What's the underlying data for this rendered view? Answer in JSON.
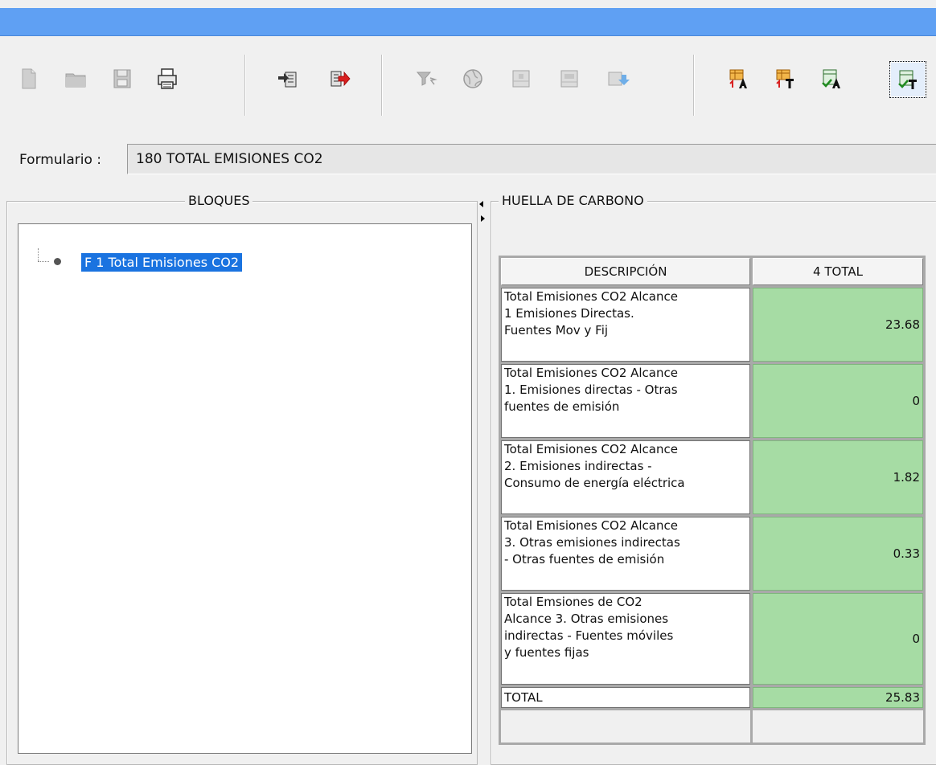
{
  "form": {
    "label": "Formulario :",
    "value": "180 TOTAL EMISIONES CO2"
  },
  "toolbar": {
    "buttons": [
      {
        "name": "new-doc-icon",
        "enabled": false
      },
      {
        "name": "folder-icon",
        "enabled": false
      },
      {
        "name": "save-disk-icon",
        "enabled": false
      },
      {
        "name": "printer-icon",
        "enabled": true
      },
      {
        "name": "import-arrow-icon",
        "enabled": true
      },
      {
        "name": "export-red-arrow-icon",
        "enabled": true
      },
      {
        "name": "filter-icon",
        "enabled": false
      },
      {
        "name": "globe-icon",
        "enabled": false
      },
      {
        "name": "grid-icon",
        "enabled": false
      },
      {
        "name": "grid-alt-icon",
        "enabled": false
      },
      {
        "name": "download-sheet-icon",
        "enabled": false
      },
      {
        "name": "sheet-a-up-icon",
        "enabled": true
      },
      {
        "name": "sheet-t-up-icon",
        "enabled": true
      },
      {
        "name": "check-a-icon",
        "enabled": true
      },
      {
        "name": "check-t-icon",
        "enabled": true,
        "active": true
      }
    ],
    "colors": {
      "accent_orange": "#e07b16",
      "accent_red": "#d82020",
      "accent_green": "#3c9a3c",
      "disabled": "#b9b9b9"
    }
  },
  "bloques": {
    "title": "BLOQUES",
    "tree": [
      {
        "label": "F 1 Total Emisiones CO2",
        "selected": true
      }
    ]
  },
  "huella": {
    "title": "HUELLA DE CARBONO",
    "columns": [
      "DESCRIPCIÓN",
      "4 TOTAL"
    ],
    "rows": [
      {
        "lines": [
          "Total Emisiones CO2 Alcance",
          "1 Emisiones Directas.",
          "Fuentes Mov y Fij"
        ],
        "value": "23.68"
      },
      {
        "lines": [
          "Total Emisiones CO2 Alcance",
          "1. Emisiones directas - Otras",
          "fuentes de emisión"
        ],
        "value": "0"
      },
      {
        "lines": [
          "Total Emisiones CO2 Alcance",
          "2. Emisiones indirectas -",
          "Consumo de energía eléctrica"
        ],
        "value": "1.82"
      },
      {
        "lines": [
          "Total Emisiones CO2 Alcance",
          "3. Otras emisiones indirectas",
          "- Otras fuentes de emisión"
        ],
        "value": "0.33"
      },
      {
        "lines": [
          "Total Emsiones de CO2",
          "Alcance 3. Otras emisiones",
          "indirectas - Fuentes móviles",
          "y fuentes fijas"
        ],
        "value": "0"
      }
    ],
    "total": {
      "label": "TOTAL",
      "value": "25.83"
    },
    "colors": {
      "value_cell": "#a6dca4",
      "selection": "#1a73e0"
    }
  }
}
